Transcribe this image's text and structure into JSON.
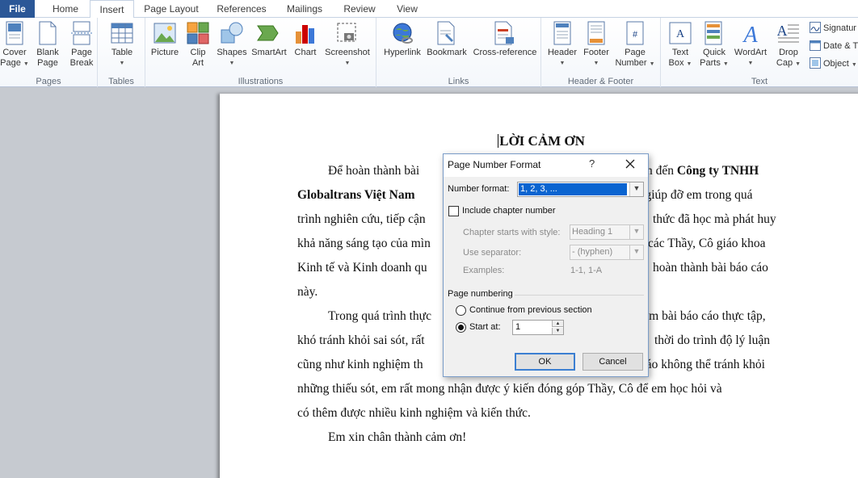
{
  "tabs": [
    {
      "label": "File"
    },
    {
      "label": "Home"
    },
    {
      "label": "Insert"
    },
    {
      "label": "Page Layout"
    },
    {
      "label": "References"
    },
    {
      "label": "Mailings"
    },
    {
      "label": "Review"
    },
    {
      "label": "View"
    }
  ],
  "ribbon": {
    "pages": {
      "label": "Pages",
      "cover_1": "Cover",
      "cover_2": "Page",
      "blank_1": "Blank",
      "blank_2": "Page",
      "break_1": "Page",
      "break_2": "Break"
    },
    "tables": {
      "label": "Tables",
      "table": "Table"
    },
    "illustrations": {
      "label": "Illustrations",
      "picture": "Picture",
      "clip_1": "Clip",
      "clip_2": "Art",
      "shapes": "Shapes",
      "smartart": "SmartArt",
      "chart": "Chart",
      "screenshot": "Screenshot"
    },
    "links": {
      "label": "Links",
      "hyperlink": "Hyperlink",
      "bookmark": "Bookmark",
      "crossref": "Cross-reference"
    },
    "header_footer": {
      "label": "Header & Footer",
      "header": "Header",
      "footer": "Footer",
      "pagenum_1": "Page",
      "pagenum_2": "Number"
    },
    "text": {
      "label": "Text",
      "textbox_1": "Text",
      "textbox_2": "Box",
      "quick_1": "Quick",
      "quick_2": "Parts",
      "wordart": "WordArt",
      "drop_1": "Drop",
      "drop_2": "Cap",
      "signature": "Signatur",
      "datetime": "Date & T",
      "object": "Object"
    }
  },
  "document": {
    "title": "LỜI CẢM ƠN",
    "p1_l1_a": "Để hoàn thành bài",
    "p1_l1_b": "n đến",
    "p1_l1_bold": "Công ty TNHH",
    "p1_l2_bold": "Globaltrans Việt Nam",
    "p1_l2_b": "đã giúp đỡ em trong quá",
    "p1_l3_a": "trình nghiên cứu, tiếp cận",
    "p1_l3_b": "thức đã học mà phát huy",
    "p1_l4_a": "khả năng sáng tạo của mìn",
    "p1_l4_b": "các Thầy, Cô giáo khoa",
    "p1_l5_a": "Kinh tế và Kinh doanh qu",
    "p1_l5_b": "hoàn thành bài báo cáo",
    "p1_l6": "này.",
    "p2_l1_a": "Trong quá trình thực",
    "p2_l1_b": "làm bài báo cáo thực tập,",
    "p2_l2_a": "khó tránh khỏi sai sót, rất",
    "p2_l2_b": "thời do trình độ lý luận",
    "p2_l3_a": "cũng như kinh nghiệm th",
    "p2_l3_b": "báo không thể tránh khỏi",
    "p2_l4": "những thiếu sót, em rất mong nhận được ý kiến đóng góp Thầy, Cô để em học hỏi và",
    "p2_l5": "có thêm được nhiều kinh nghiệm và kiến thức.",
    "p3": "Em xin chân thành cảm ơn!"
  },
  "dialog": {
    "title": "Page Number Format",
    "help": "?",
    "number_format_label": "Number format:",
    "number_format_value": "1, 2, 3, ...",
    "include_chapter": "Include chapter number",
    "chapter_style_label": "Chapter starts with style:",
    "chapter_style_value": "Heading 1",
    "separator_label": "Use separator:",
    "separator_value": "-  (hyphen)",
    "examples_label": "Examples:",
    "examples_value": "1-1, 1-A",
    "page_numbering": "Page numbering",
    "continue_label": "Continue from previous section",
    "start_at_label": "Start at:",
    "start_at_value": "1",
    "ok": "OK",
    "cancel": "Cancel"
  }
}
